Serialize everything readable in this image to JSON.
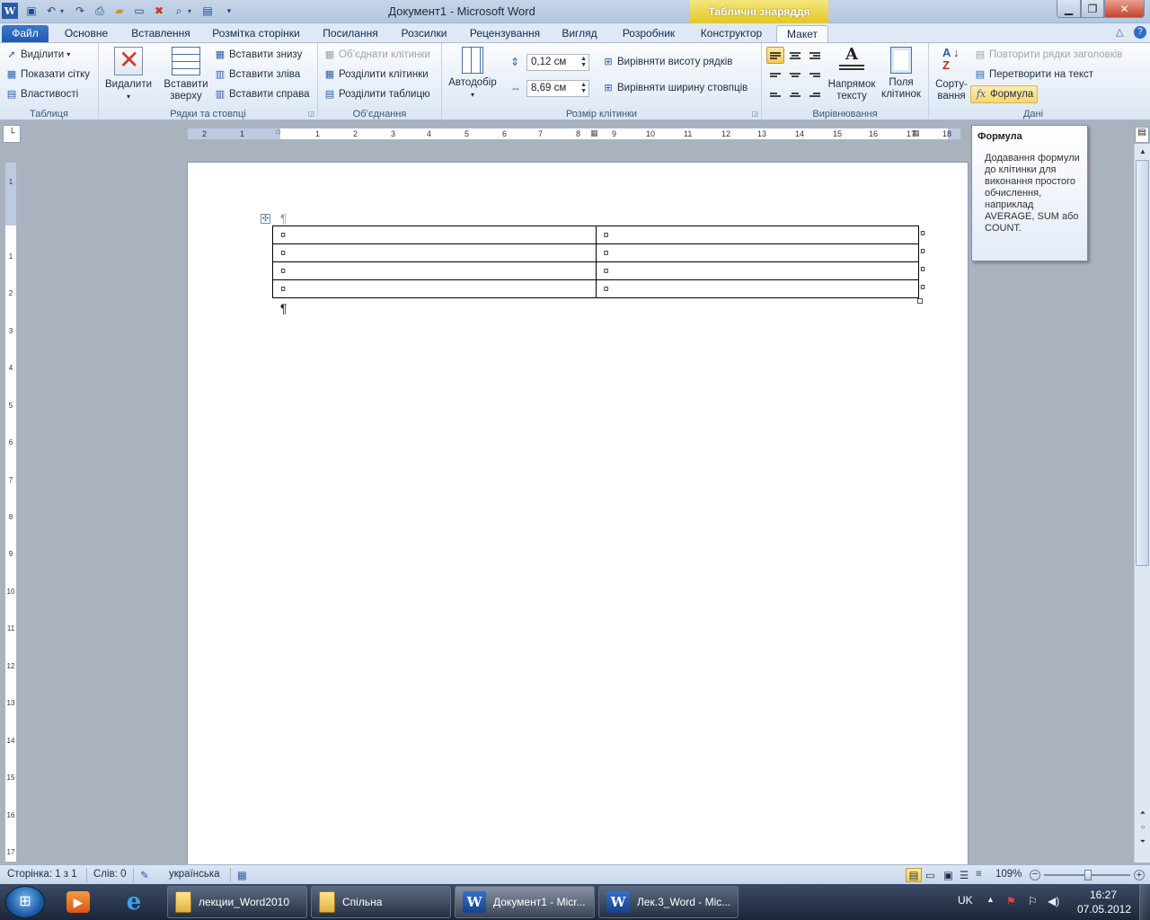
{
  "window": {
    "title": "Документ1 - Microsoft Word",
    "contextual_group": "Табличні знаряддя"
  },
  "quick_access": {
    "icons": [
      "word-app-icon",
      "save-icon",
      "undo-icon",
      "redo-icon",
      "print-preview-icon",
      "open-icon",
      "new-icon",
      "close-doc-icon",
      "zoom-icon",
      "layout-icon",
      "customize-icon"
    ]
  },
  "tabs": [
    "Файл",
    "Основне",
    "Вставлення",
    "Розмітка сторінки",
    "Посилання",
    "Розсилки",
    "Рецензування",
    "Вигляд",
    "Розробник",
    "Конструктор",
    "Макет"
  ],
  "ribbon": {
    "table_group": {
      "label": "Таблиця",
      "select": "Виділити",
      "show_grid": "Показати сітку",
      "properties": "Властивості"
    },
    "rows_cols_group": {
      "label": "Рядки та стовпці",
      "delete": "Видалити",
      "insert_above": "Вставити зверху",
      "insert_below": "Вставити знизу",
      "insert_left": "Вставити зліва",
      "insert_right": "Вставити справа"
    },
    "merge_group": {
      "label": "Об’єднання",
      "merge_cells": "Об’єднати клітинки",
      "split_cells": "Розділити клітинки",
      "split_table": "Розділити таблицю"
    },
    "cell_size_group": {
      "label": "Розмір клітинки",
      "autofit": "Автодобір",
      "height_value": "0,12 см",
      "width_value": "8,69 см",
      "distribute_rows": "Вирівняти висоту рядків",
      "distribute_cols": "Вирівняти ширину стовпців"
    },
    "alignment_group": {
      "label": "Вирівнювання",
      "text_direction": "Напрямок тексту",
      "cell_margins": "Поля клітинок"
    },
    "data_group": {
      "label": "Дані",
      "sort": "Сорту-вання",
      "repeat_header": "Повторити рядки заголовків",
      "convert_text": "Перетворити на текст",
      "formula": "Формула"
    }
  },
  "ruler": {
    "h_ticks": [
      "2",
      "1",
      "1",
      "2",
      "3",
      "4",
      "5",
      "6",
      "7",
      "8",
      "9",
      "10",
      "11",
      "12",
      "13",
      "14",
      "15",
      "16",
      "17",
      "18"
    ],
    "v_ticks": [
      "1",
      "1",
      "2",
      "3",
      "4",
      "5",
      "6",
      "7",
      "8",
      "9",
      "10",
      "11",
      "12",
      "13",
      "14",
      "15",
      "16",
      "17"
    ]
  },
  "document": {
    "paragraph_mark": "¶",
    "cell_mark": "¤",
    "table": [
      [
        "¤",
        "¤"
      ],
      [
        "¤",
        "¤"
      ],
      [
        "¤",
        "¤"
      ],
      [
        "¤",
        "¤"
      ]
    ]
  },
  "tooltip": {
    "title": "Формула",
    "body": "Додавання формули до клітинки для виконання простого обчислення, наприклад AVERAGE, SUM або COUNT."
  },
  "statusbar": {
    "page": "Сторінка: 1 з 1",
    "words": "Слів: 0",
    "language": "українська",
    "zoom": "109%"
  },
  "taskbar": {
    "items": [
      "лекции_Word2010",
      "Спільна",
      "Документ1 - Micr...",
      "Лек.3_Word - Mic..."
    ],
    "lang": "UK",
    "time": "16:27",
    "date": "07.05.2012"
  }
}
